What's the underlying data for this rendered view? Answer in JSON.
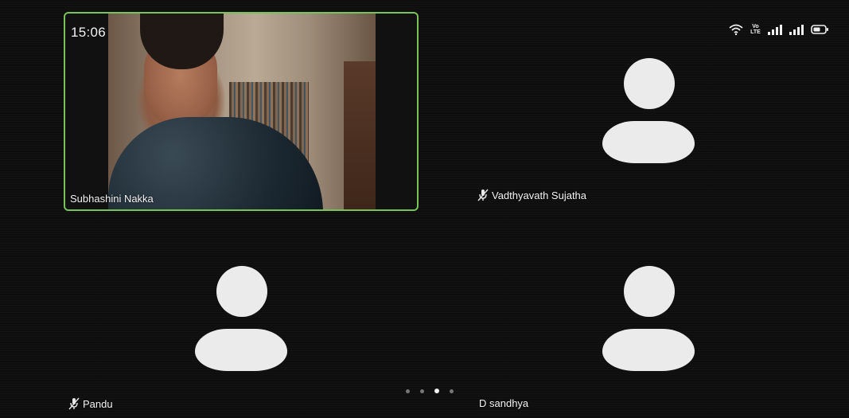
{
  "status_bar": {
    "time": "15:06",
    "volte_label_top": "Vo",
    "volte_label_bottom": "LTE",
    "icons": [
      "wifi-icon",
      "volte-icon",
      "signal-icon",
      "signal-icon",
      "battery-icon"
    ]
  },
  "participants": [
    {
      "name": "Subhashini Nakka",
      "muted": false,
      "video_on": true,
      "speaking": true
    },
    {
      "name": "Vadthyavath Sujatha",
      "muted": true,
      "video_on": false,
      "speaking": false
    },
    {
      "name": "Pandu",
      "muted": true,
      "video_on": false,
      "speaking": false
    },
    {
      "name": "D sandhya",
      "muted": false,
      "video_on": false,
      "speaking": false
    }
  ],
  "pager": {
    "page_count": 4,
    "active_index": 2
  },
  "colors": {
    "active_speaker_border": "#78c257",
    "background": "#0e0e0e",
    "avatar": "#ebebeb",
    "text": "#f4f4f4"
  }
}
